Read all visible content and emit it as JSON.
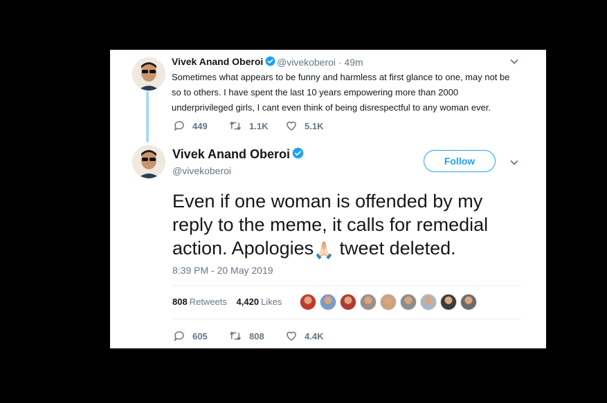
{
  "reply_tweet": {
    "name": "Vivek Anand Oberoi",
    "handle_time": "@vivekoberoi · 49m",
    "body": "Sometimes what appears to be funny and harmless at first glance to one, may not be so to others. I have spent the last 10 years empowering more than 2000 underprivileged girls, I cant even think of being disrespectful to any woman ever.",
    "replies": "449",
    "retweets": "1.1K",
    "likes": "5.1K"
  },
  "main_tweet": {
    "name": "Vivek Anand Oberoi",
    "handle": "@vivekoberoi",
    "follow_label": "Follow",
    "body_part1": "Even if one woman is offended by my reply to the meme, it calls for remedial action. Apologies",
    "emoji": "🙏🏻",
    "body_part2": " tweet deleted.",
    "timestamp": "8:39 PM - 20 May 2019",
    "retweet_count": "808",
    "retweet_label": "Retweets",
    "like_count": "4,420",
    "like_label": "Likes",
    "replies": "605",
    "retweets": "808",
    "likes": "4.4K"
  },
  "colors": {
    "accent": "#1da1f2",
    "thread_line": "#a8d8f2",
    "muted": "#657786"
  },
  "liker_avatar_colors": [
    "#c0392b",
    "#7a9cc6",
    "#b03a2e",
    "#9a8f87",
    "#c9a27e",
    "#8c8c8c",
    "#a9b6c2",
    "#3b3b3b",
    "#6b6b6b"
  ]
}
